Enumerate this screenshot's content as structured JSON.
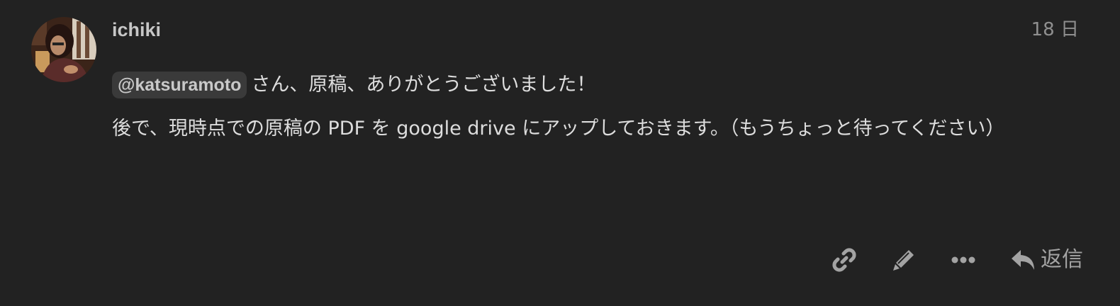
{
  "post": {
    "username": "ichiki",
    "date": "18 日",
    "mention": "@katsuramoto",
    "paragraph1_text": "さん、原稿、ありがとうございました！",
    "paragraph2_text": "後で、現時点での原稿の PDF を google drive にアップしておきます。（もうちょっと待ってください）"
  },
  "actions": {
    "link_icon": "link-icon",
    "edit_icon": "pencil-icon",
    "more_icon": "ellipsis-icon",
    "reply_icon": "reply-arrow-icon",
    "reply_label": "返信"
  },
  "colors": {
    "background": "#222222",
    "text": "#dddddd",
    "muted": "#8f8f8f",
    "icon": "#a3a3a3",
    "mention_bg": "#3a3a3a"
  }
}
